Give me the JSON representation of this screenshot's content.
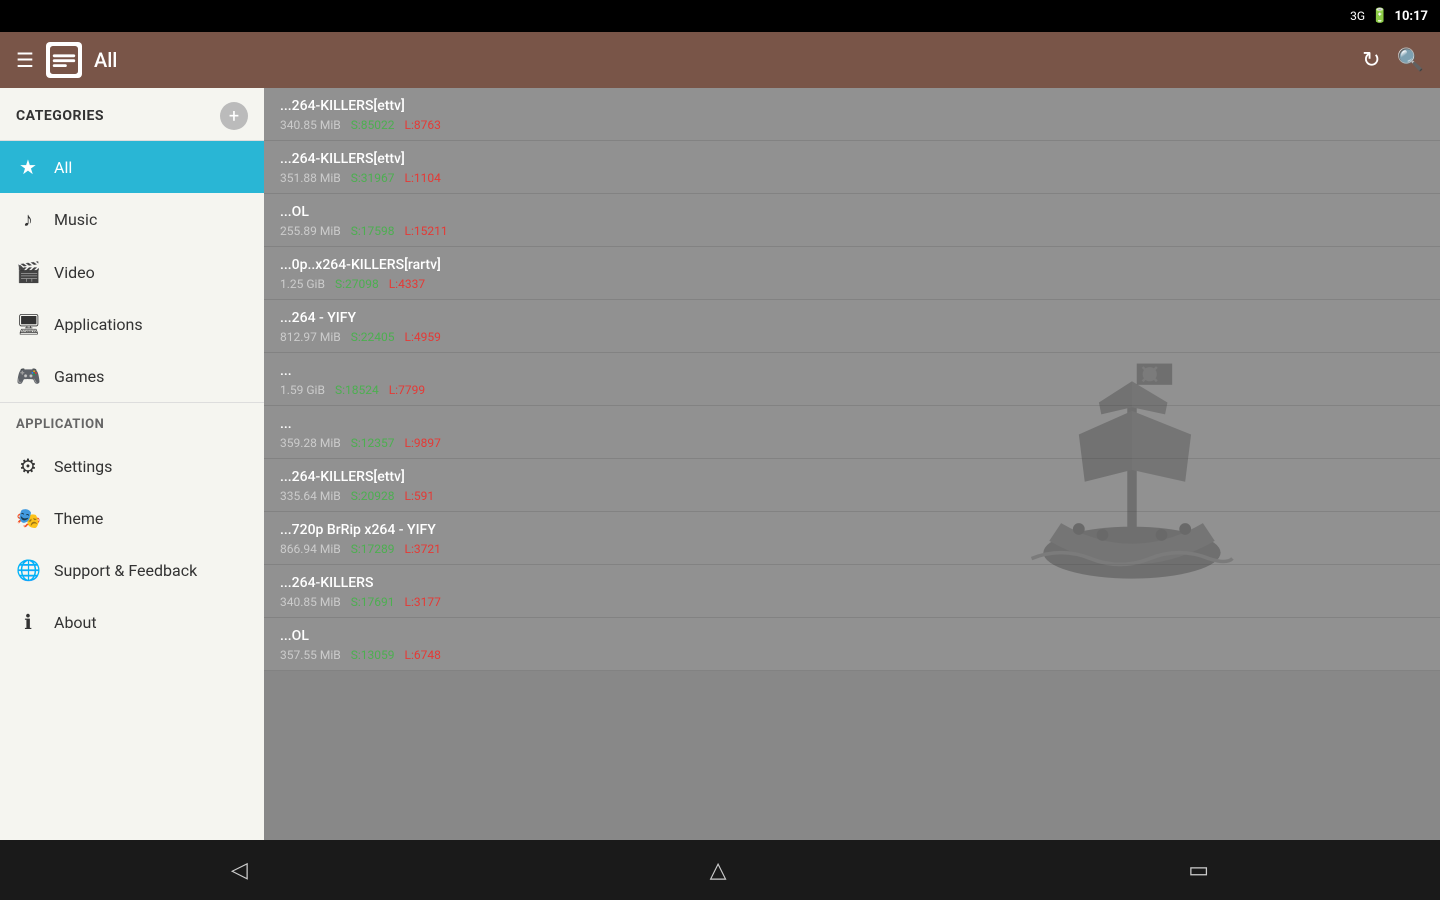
{
  "statusBar": {
    "signal": "3G",
    "battery": "🔋",
    "time": "10:17"
  },
  "appBar": {
    "title": "All",
    "appIcon": "🏴",
    "refreshIcon": "↻",
    "searchIcon": "🔍"
  },
  "sidebar": {
    "categoriesLabel": "CATEGORIES",
    "applicationLabel": "APPLICATION",
    "addIcon": "+",
    "categories": [
      {
        "id": "all",
        "label": "All",
        "icon": "★",
        "active": true
      },
      {
        "id": "music",
        "label": "Music",
        "icon": "♪"
      },
      {
        "id": "video",
        "label": "Video",
        "icon": "🎬"
      },
      {
        "id": "applications",
        "label": "Applications",
        "icon": "🖥"
      },
      {
        "id": "games",
        "label": "Games",
        "icon": "🎮"
      }
    ],
    "appItems": [
      {
        "id": "settings",
        "label": "Settings",
        "icon": "⚙"
      },
      {
        "id": "theme",
        "label": "Theme",
        "icon": "🎭"
      },
      {
        "id": "support",
        "label": "Support & Feedback",
        "icon": "🌐"
      },
      {
        "id": "about",
        "label": "About",
        "icon": "ℹ"
      }
    ]
  },
  "torrents": [
    {
      "title": "...264-KILLERS[ettv]",
      "size": "340.85 MiB",
      "seeders": "S:85022",
      "leechers": "L:8763"
    },
    {
      "title": "...264-KILLERS[ettv]",
      "size": "351.88 MiB",
      "seeders": "S:31967",
      "leechers": "L:1104"
    },
    {
      "title": "...OL",
      "size": "255.89 MiB",
      "seeders": "S:17598",
      "leechers": "L:15211"
    },
    {
      "title": "...0p..x264-KILLERS[rartv]",
      "size": "1.25 GiB",
      "seeders": "S:27098",
      "leechers": "L:4337"
    },
    {
      "title": "...264 - YIFY",
      "size": "812.97 MiB",
      "seeders": "S:22405",
      "leechers": "L:4959"
    },
    {
      "title": "...",
      "size": "1.59 GiB",
      "seeders": "S:18524",
      "leechers": "L:7799"
    },
    {
      "title": "...",
      "size": "359.28 MiB",
      "seeders": "S:12357",
      "leechers": "L:9897"
    },
    {
      "title": "...264-KILLERS[ettv]",
      "size": "335.64 MiB",
      "seeders": "S:20928",
      "leechers": "L:591"
    },
    {
      "title": "...720p BrRip x264 - YIFY",
      "size": "866.94 MiB",
      "seeders": "S:17289",
      "leechers": "L:3721"
    },
    {
      "title": "...264-KILLERS",
      "size": "340.85 MiB",
      "seeders": "S:17691",
      "leechers": "L:3177"
    },
    {
      "title": "...OL",
      "size": "357.55 MiB",
      "seeders": "S:13059",
      "leechers": "L:6748"
    }
  ],
  "bottomNav": {
    "backIcon": "◁",
    "homeIcon": "△",
    "recentsIcon": "□"
  }
}
